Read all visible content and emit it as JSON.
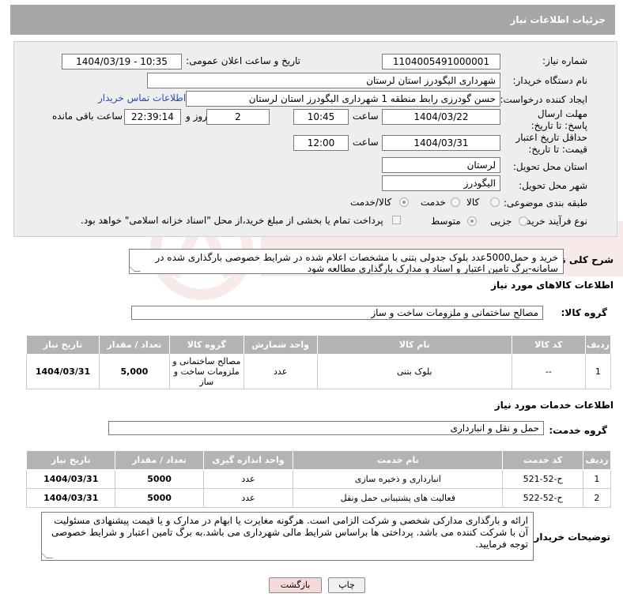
{
  "header": {
    "title": "جزئیات اطلاعات نیاز"
  },
  "form": {
    "need_number_label": "شماره نیاز:",
    "need_number": "1104005491000001",
    "announce_label": "تاریخ و ساعت اعلان عمومی:",
    "announce_value": "1404/03/19 - 10:35",
    "buyer_org_label": "نام دستگاه خریدار:",
    "buyer_org": "شهرداری الیگودرز استان لرستان",
    "creator_label": "ایجاد کننده درخواست:",
    "creator": "حسن گودرزی رابط منطقه 1 شهرداری الیگودرز استان لرستان",
    "contact_link": "اطلاعات تماس خریدار",
    "deadline_label": "مهلت ارسال پاسخ: تا تاریخ:",
    "deadline_date": "1404/03/22",
    "time_label": "ساعت",
    "deadline_time": "10:45",
    "days_value": "2",
    "days_label": "روز و",
    "remaining_time": "22:39:14",
    "remaining_label": "ساعت باقی مانده",
    "validity_label": "حداقل تاریخ اعتبار قیمت: تا تاریخ:",
    "validity_date": "1404/03/31",
    "validity_time": "12:00",
    "province_label": "استان محل تحویل:",
    "province": "لرستان",
    "city_label": "شهر محل تحویل:",
    "city": "الیگودرز",
    "category_label": "طبقه بندی موضوعی:",
    "category_options": [
      "کالا",
      "خدمت",
      "کالا/خدمت"
    ],
    "process_label": "نوع فرآیند خرید :",
    "process_options": [
      "جزیی",
      "متوسط"
    ],
    "payment_note": "پرداخت تمام یا بخشی از مبلغ خرید،از محل \"اسناد خزانه اسلامی\" خواهد بود."
  },
  "description": {
    "label": "شرح کلی نیاز:",
    "text": "خرید و حمل5000عدد بلوک جدولی بتنی با مشخصات اعلام شده در شرایط خصوصی بارگذاری شده در سامانه-برگ تامین اعتبار و اسناد و مدارک بارگذاری مطالعه شود"
  },
  "goods": {
    "section_title": "اطلاعات کالاهای مورد نیاز",
    "group_label": "گروه کالا:",
    "group_value": "مصالح ساختمانی و ملزومات ساخت و ساز",
    "headers": [
      "ردیف",
      "کد کالا",
      "نام کالا",
      "واحد شمارش",
      "گروه کالا",
      "تعداد / مقدار",
      "تاریخ نیاز"
    ],
    "rows": [
      {
        "row": "1",
        "code": "--",
        "name": "بلوک بتنی",
        "unit": "عدد",
        "group": "مصالح ساختمانی و ملزومات ساخت و ساز",
        "qty": "5,000",
        "date": "1404/03/31"
      }
    ]
  },
  "services": {
    "section_title": "اطلاعات خدمات مورد نیاز",
    "group_label": "گروه خدمت:",
    "group_value": "حمل و نقل و انبارداری",
    "headers": [
      "ردیف",
      "کد خدمت",
      "نام خدمت",
      "واحد اندازه گیری",
      "تعداد / مقدار",
      "تاریخ نیاز"
    ],
    "rows": [
      {
        "row": "1",
        "code": "ح-52-521",
        "name": "انبارداری و ذخیره سازی",
        "unit": "عدد",
        "qty": "5000",
        "date": "1404/03/31"
      },
      {
        "row": "2",
        "code": "ح-52-522",
        "name": "فعالیت های پشتیبانی حمل ونقل",
        "unit": "عدد",
        "qty": "5000",
        "date": "1404/03/31"
      }
    ]
  },
  "buyer_notes": {
    "label": "توضیحات خریدار:",
    "text": "ارائه و بارگذاری مدارکی شخصی و شرکت الزامی است. هرگونه مغایرت یا ابهام در مدارک و یا قیمت پیشنهادی مسئولیت آن با شرکت کننده می باشد. پرداختی ها براساس شرایط مالی شهرداری می باشد.به برگ تامین اعتبار و شرایط خصوصی توجه فرمایید."
  },
  "buttons": {
    "print": "چاپ",
    "back": "بازگشت"
  },
  "colors": {
    "header_bg": "#a7a7a7",
    "panel_bg": "#eeeeee",
    "link": "#2a4fa8",
    "back_bg": "#f6d9d9"
  }
}
